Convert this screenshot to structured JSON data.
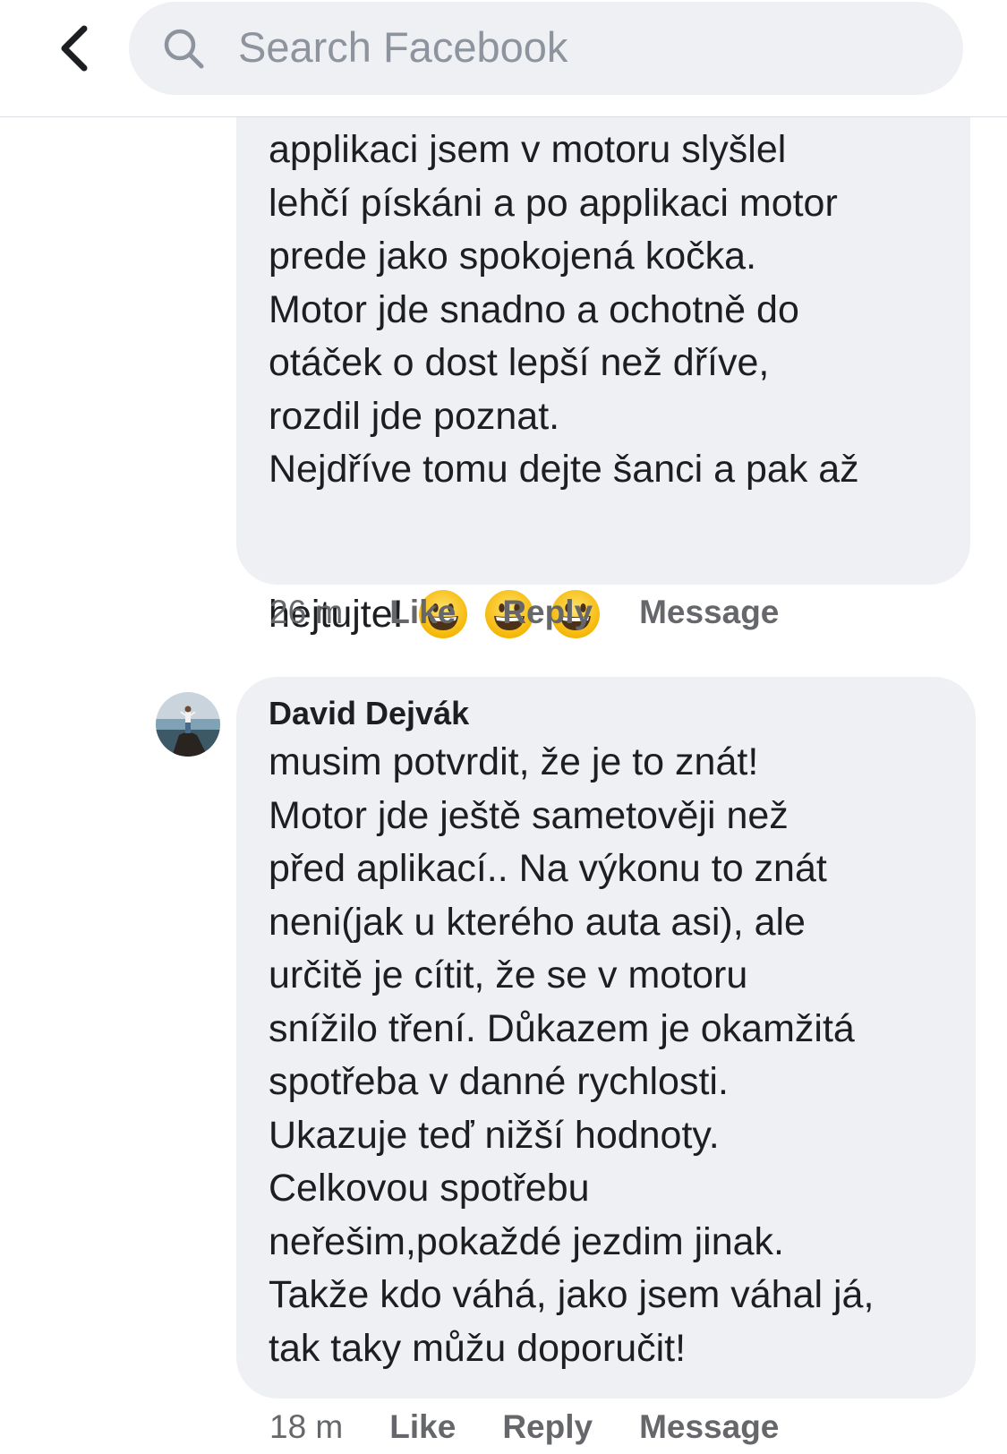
{
  "header": {
    "search_placeholder": "Search Facebook"
  },
  "comments": [
    {
      "text": "applikaci jsem v motoru slyšlel\nlehčí pískáni a po applikaci motor\nprede jako spokojená kočka.\nMotor jde snadno a ochotně do\notáček o dost lepší než dříve,\nrozdil jde poznat.\nNejdříve tomu dejte šanci a pak až",
      "last_line": "hejtujte!",
      "emoji_icons": [
        "grinning-face-icon",
        "grinning-face-icon",
        "grinning-face-icon"
      ],
      "time": "26 m",
      "like_label": "Like",
      "reply_label": "Reply",
      "message_label": "Message"
    },
    {
      "author": "David Dejvák",
      "text": "musim potvrdit, že je to znát!\nMotor jde ještě sametověji než\npřed aplikací.. Na výkonu to znát\nneni(jak u kterého auta asi), ale\nurčitě je cítit, že se v motoru\nsnížilo tření. Důkazem je okamžitá\nspotřeba v danné rychlosti.\nUkazuje teď nižší hodnoty.\nCelkovou spotřebu\nneřešim,pokaždé jezdim jinak.\nTakže kdo váhá, jako jsem váhal já,\ntak taky můžu doporučit!",
      "time": "18 m",
      "like_label": "Like",
      "reply_label": "Reply",
      "message_label": "Message"
    }
  ],
  "colors": {
    "bubble_bg": "#eef0f3",
    "meta_text": "#65676b",
    "body_text": "#1c1e21"
  }
}
